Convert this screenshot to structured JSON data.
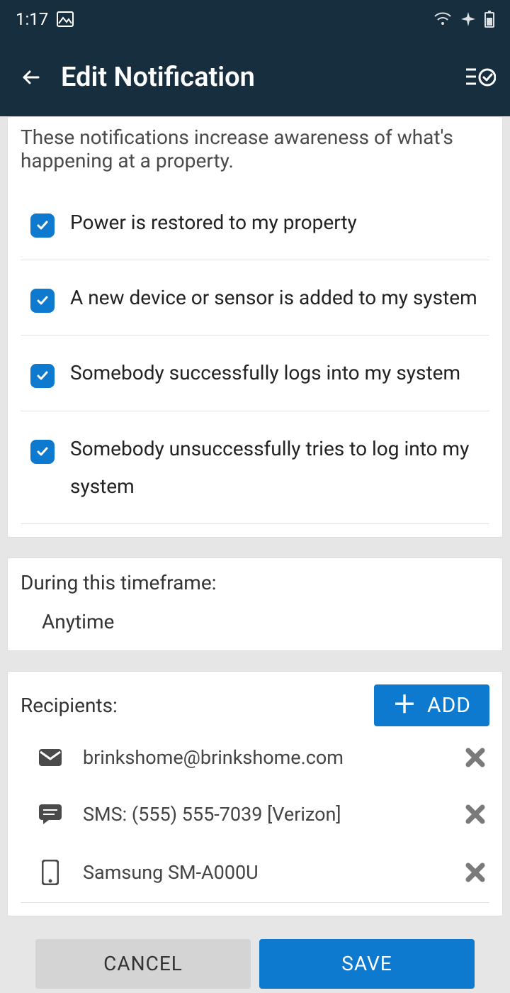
{
  "statusbar": {
    "time": "1:17"
  },
  "appbar": {
    "title": "Edit Notification"
  },
  "notifications": {
    "intro": "These notifications increase awareness of what's happening at a property.",
    "options": [
      {
        "checked": true,
        "label": "Power is restored to my property"
      },
      {
        "checked": true,
        "label": "A new device or sensor is added to my system"
      },
      {
        "checked": true,
        "label": "Somebody successfully logs into my system"
      },
      {
        "checked": true,
        "label": "Somebody unsuccessfully tries to log into my system"
      }
    ]
  },
  "timeframe": {
    "title": "During this timeframe:",
    "value": "Anytime"
  },
  "recipients": {
    "title": "Recipients:",
    "add_label": "ADD",
    "items": [
      {
        "type": "email",
        "text": "brinkshome@brinkshome.com"
      },
      {
        "type": "sms",
        "text": "SMS: (555) 555-7039 [Verizon]"
      },
      {
        "type": "device",
        "text": "Samsung SM-A000U"
      }
    ]
  },
  "footer": {
    "cancel": "CANCEL",
    "save": "SAVE"
  }
}
